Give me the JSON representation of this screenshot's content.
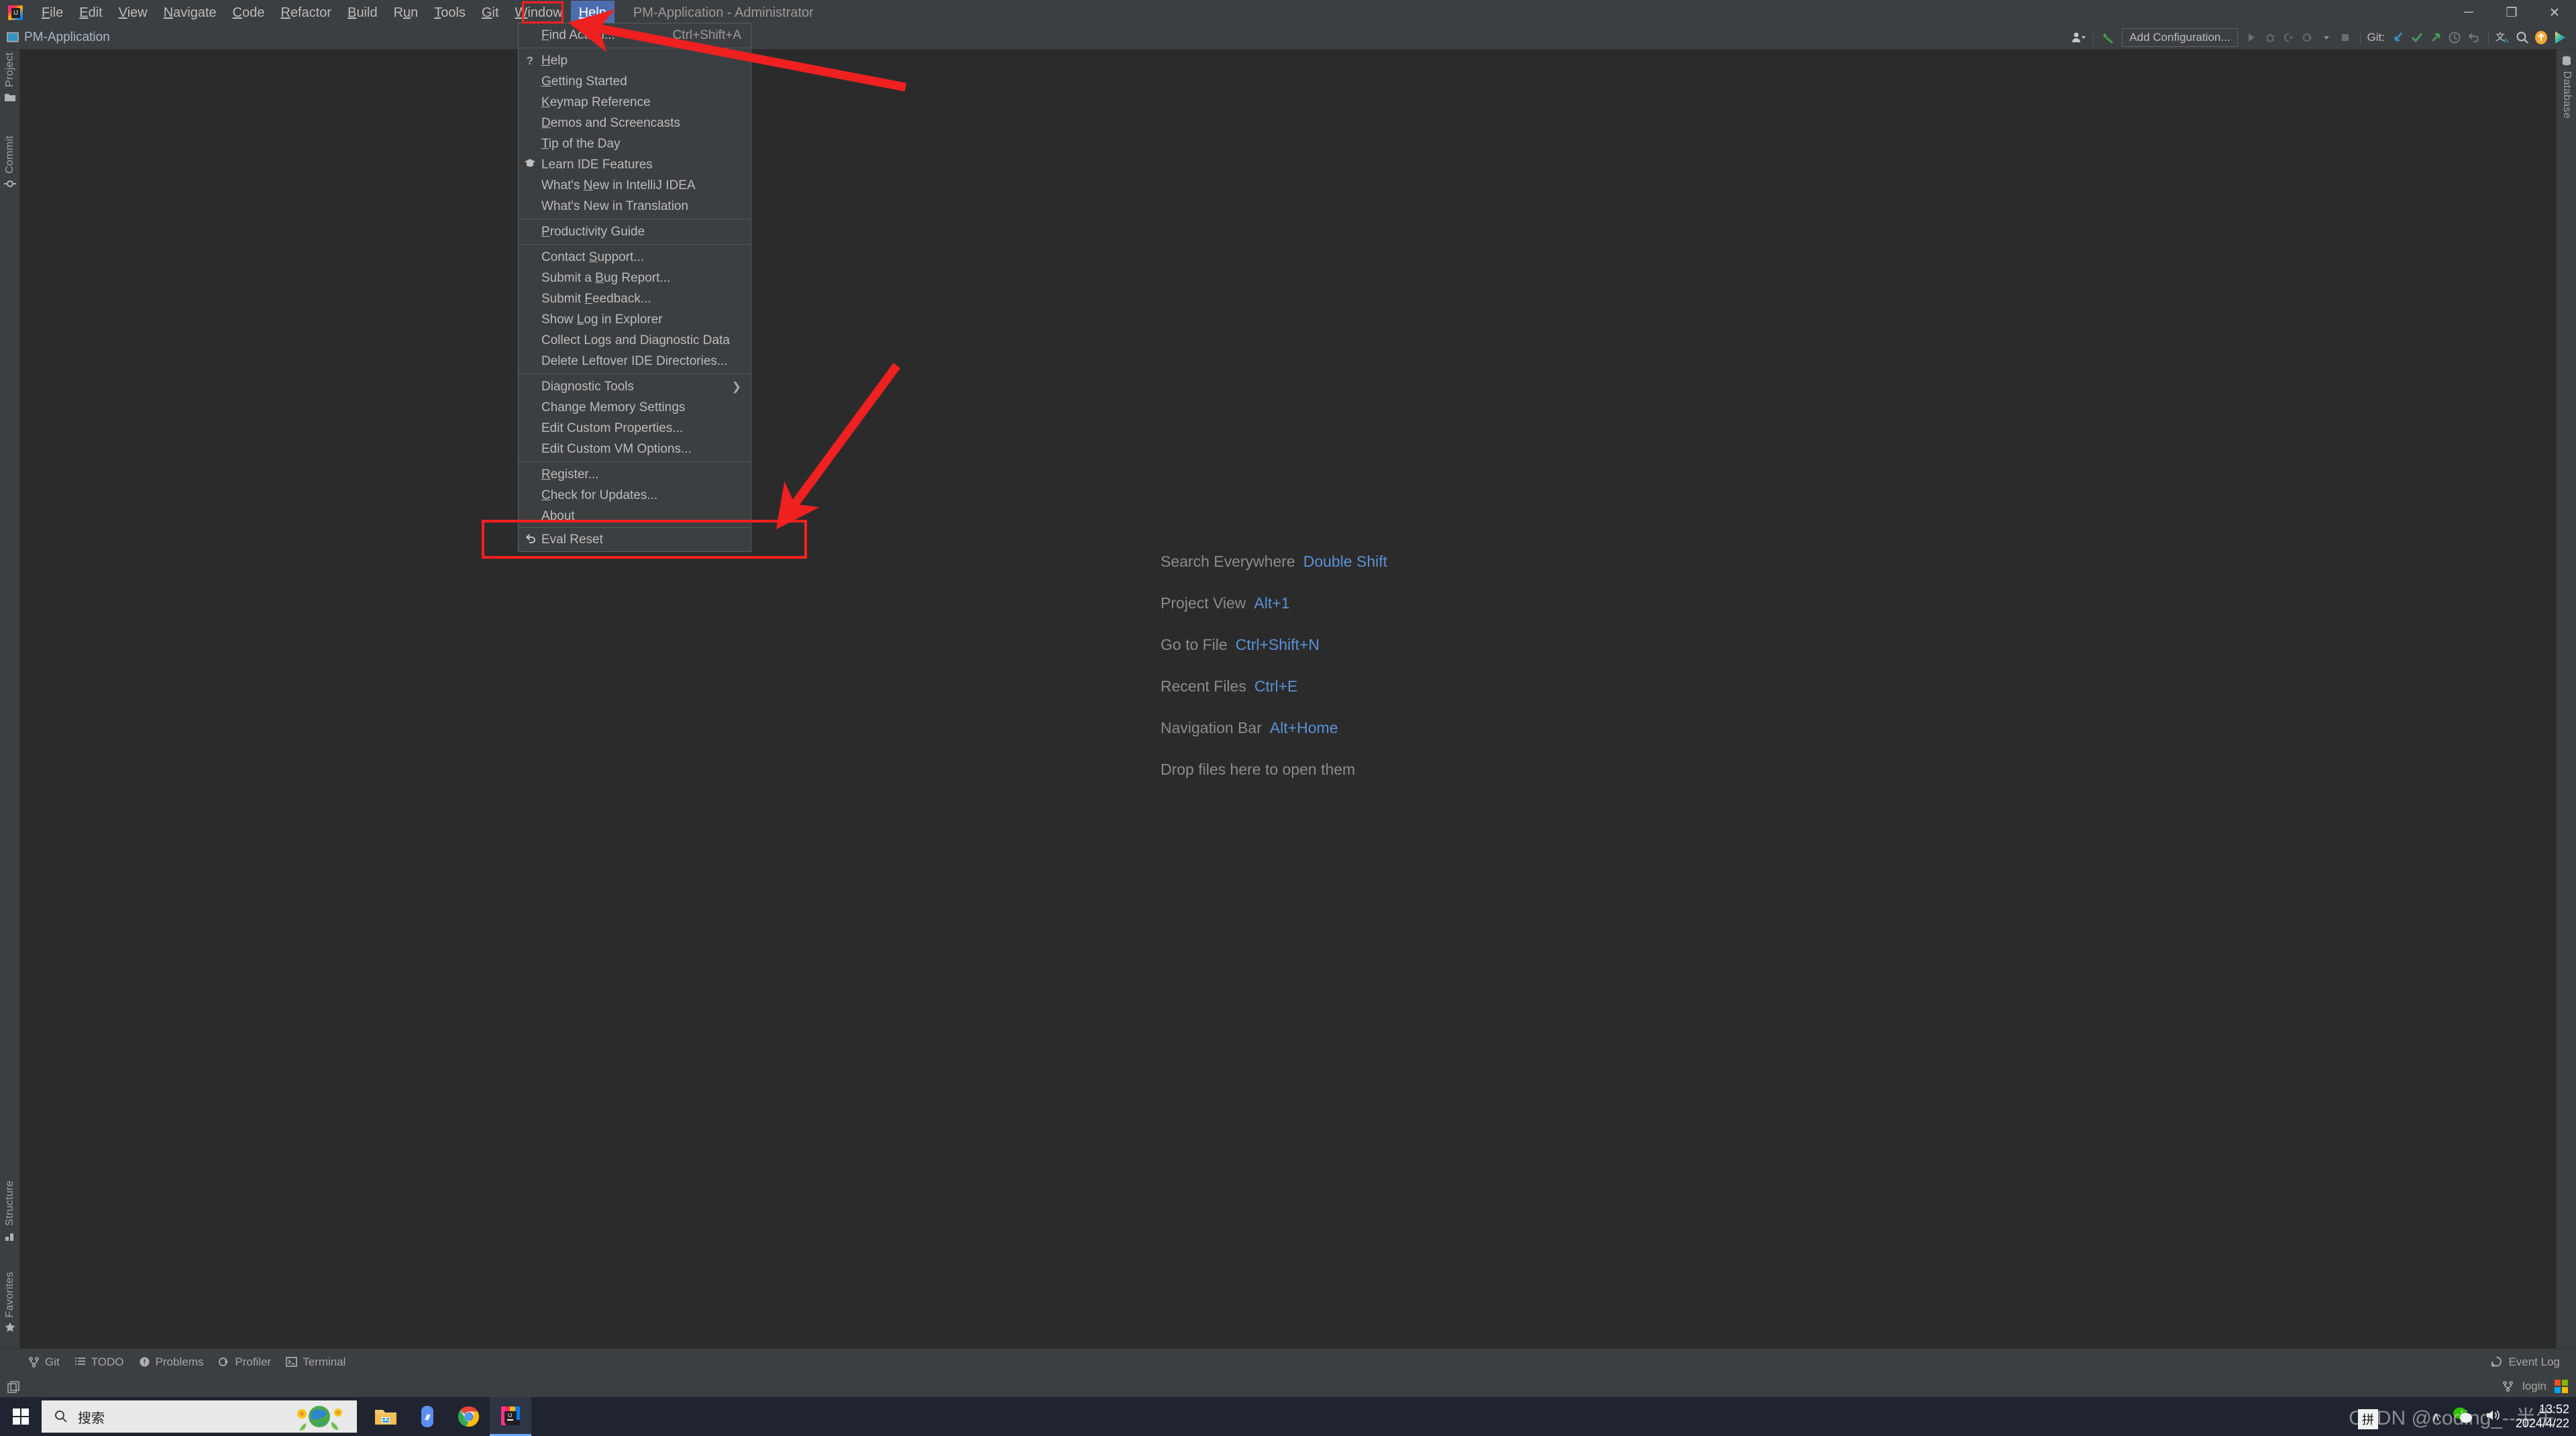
{
  "window": {
    "title": "PM-Application - Administrator",
    "controls": [
      {
        "name": "minimize",
        "glyph": "─"
      },
      {
        "name": "restore",
        "glyph": "❐"
      },
      {
        "name": "close",
        "glyph": "✕"
      }
    ]
  },
  "menubar": {
    "items": [
      {
        "label": "File",
        "mnemonic": "F"
      },
      {
        "label": "Edit",
        "mnemonic": "E"
      },
      {
        "label": "View",
        "mnemonic": "V"
      },
      {
        "label": "Navigate",
        "mnemonic": "N"
      },
      {
        "label": "Code",
        "mnemonic": "C"
      },
      {
        "label": "Refactor",
        "mnemonic": "R"
      },
      {
        "label": "Build",
        "mnemonic": "B"
      },
      {
        "label": "Run",
        "mnemonic": "u"
      },
      {
        "label": "Tools",
        "mnemonic": "T"
      },
      {
        "label": "Git",
        "mnemonic": "G"
      },
      {
        "label": "Window",
        "mnemonic": "W"
      },
      {
        "label": "Help",
        "mnemonic": "H",
        "active": true
      }
    ]
  },
  "navbar": {
    "project_name": "PM-Application",
    "add_configuration_label": "Add Configuration...",
    "git_label": "Git:"
  },
  "help_menu": {
    "groups": [
      [
        {
          "label": "Find Action...",
          "mnemonic": "F",
          "accel": "Ctrl+Shift+A",
          "icon": ""
        }
      ],
      [
        {
          "label": "Help",
          "mnemonic": "H",
          "icon": "?"
        },
        {
          "label": "Getting Started",
          "mnemonic": "G",
          "icon": ""
        },
        {
          "label": "Keymap Reference",
          "mnemonic": "K",
          "icon": ""
        },
        {
          "label": "Demos and Screencasts",
          "mnemonic": "D",
          "icon": ""
        },
        {
          "label": "Tip of the Day",
          "mnemonic": "T",
          "icon": ""
        },
        {
          "label": "Learn IDE Features",
          "icon": "graduation-cap"
        },
        {
          "label": "What's New in IntelliJ IDEA",
          "mnemonic": "N",
          "icon": ""
        },
        {
          "label": "What's New in Translation",
          "icon": ""
        }
      ],
      [
        {
          "label": "Productivity Guide",
          "mnemonic": "P",
          "icon": ""
        }
      ],
      [
        {
          "label": "Contact Support...",
          "mnemonic": "S",
          "icon": ""
        },
        {
          "label": "Submit a Bug Report...",
          "mnemonic": "B",
          "icon": ""
        },
        {
          "label": "Submit Feedback...",
          "mnemonic": "F",
          "icon": ""
        },
        {
          "label": "Show Log in Explorer",
          "mnemonic": "L",
          "icon": ""
        },
        {
          "label": "Collect Logs and Diagnostic Data",
          "icon": ""
        },
        {
          "label": "Delete Leftover IDE Directories...",
          "icon": ""
        }
      ],
      [
        {
          "label": "Diagnostic Tools",
          "icon": "",
          "submenu": true
        },
        {
          "label": "Change Memory Settings",
          "icon": ""
        },
        {
          "label": "Edit Custom Properties...",
          "icon": ""
        },
        {
          "label": "Edit Custom VM Options...",
          "icon": ""
        }
      ],
      [
        {
          "label": "Register...",
          "mnemonic": "R",
          "icon": ""
        },
        {
          "label": "Check for Updates...",
          "mnemonic": "C",
          "icon": ""
        },
        {
          "label": "About",
          "mnemonic": "A",
          "icon": ""
        }
      ]
    ],
    "eval_reset": {
      "label": "Eval Reset",
      "icon": "undo-arrow"
    }
  },
  "editor": {
    "shortcuts": [
      {
        "action": "Search Everywhere",
        "key": "Double Shift"
      },
      {
        "action": "Project View",
        "key": "Alt+1"
      },
      {
        "action": "Go to File",
        "key": "Ctrl+Shift+N"
      },
      {
        "action": "Recent Files",
        "key": "Ctrl+E"
      },
      {
        "action": "Navigation Bar",
        "key": "Alt+Home"
      }
    ],
    "drop_hint": "Drop files here to open them"
  },
  "left_tool_strip": {
    "items": [
      {
        "label": "Project",
        "icon": "folder-icon"
      },
      {
        "label": "Commit",
        "icon": "commit-icon"
      }
    ],
    "bottom_items": [
      {
        "label": "Structure",
        "icon": "structure-icon"
      },
      {
        "label": "Favorites",
        "icon": "star-icon"
      }
    ]
  },
  "right_tool_strip": {
    "items": [
      {
        "label": "Database",
        "icon": "database-icon"
      }
    ]
  },
  "bottom_tool_strip": {
    "items": [
      {
        "label": "Git",
        "icon": "git-branch-icon"
      },
      {
        "label": "TODO",
        "icon": "todo-list-icon"
      },
      {
        "label": "Problems",
        "icon": "problems-icon"
      },
      {
        "label": "Profiler",
        "icon": "profiler-icon"
      },
      {
        "label": "Terminal",
        "icon": "terminal-icon"
      }
    ],
    "event_log": {
      "label": "Event Log",
      "icon": "event-log-icon"
    }
  },
  "status_bar": {
    "branch": "login",
    "branch_icon": "git-branch-icon"
  },
  "taskbar": {
    "search_placeholder": "搜索",
    "apps": [
      {
        "name": "file-explorer-icon"
      },
      {
        "name": "onedrive-icon"
      },
      {
        "name": "chrome-icon"
      },
      {
        "name": "intellij-idea-icon",
        "active": true
      }
    ],
    "tray": {
      "chevron": "∧",
      "wechat": "wechat-icon",
      "volume": "volume-icon",
      "ime": "拼"
    },
    "clock": {
      "time": "13:52",
      "date": "2024/4/22"
    }
  },
  "watermark": {
    "text": "CSDN @coding_--半生"
  },
  "colors": {
    "background": "#3c3f41",
    "editor_background": "#2b2b2b",
    "accent_blue": "#4b6eaf",
    "key_blue": "#5a91d6",
    "annotation_red": "#ff1f1f",
    "text": "#bbbbbb"
  }
}
